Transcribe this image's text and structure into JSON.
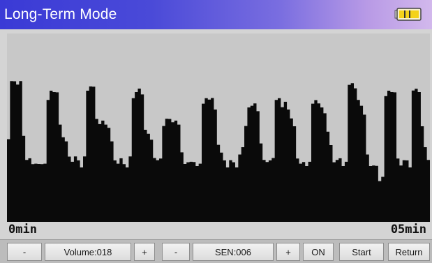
{
  "title": "Long-Term Mode",
  "status": {
    "battery_icon": "battery-icon",
    "battery_color": "#f4d21a"
  },
  "plot": {
    "start_label": "0min",
    "end_label": "05min",
    "background": "#c8c8c8",
    "signal_color": "#0a0a0a",
    "samples": [
      0.45,
      0.74,
      0.75,
      0.74,
      0.74,
      0.46,
      0.34,
      0.33,
      0.31,
      0.32,
      0.3,
      0.31,
      0.32,
      0.64,
      0.7,
      0.7,
      0.68,
      0.52,
      0.46,
      0.42,
      0.35,
      0.33,
      0.34,
      0.33,
      0.3,
      0.34,
      0.7,
      0.73,
      0.71,
      0.55,
      0.53,
      0.53,
      0.52,
      0.51,
      0.42,
      0.33,
      0.32,
      0.33,
      0.31,
      0.3,
      0.34,
      0.66,
      0.7,
      0.7,
      0.68,
      0.5,
      0.46,
      0.44,
      0.35,
      0.32,
      0.34,
      0.52,
      0.54,
      0.55,
      0.54,
      0.53,
      0.52,
      0.38,
      0.3,
      0.32,
      0.33,
      0.31,
      0.3,
      0.32,
      0.62,
      0.66,
      0.66,
      0.65,
      0.6,
      0.42,
      0.36,
      0.33,
      0.3,
      0.32,
      0.32,
      0.3,
      0.35,
      0.4,
      0.52,
      0.6,
      0.62,
      0.64,
      0.58,
      0.42,
      0.34,
      0.31,
      0.33,
      0.35,
      0.64,
      0.66,
      0.62,
      0.63,
      0.6,
      0.56,
      0.5,
      0.34,
      0.32,
      0.31,
      0.3,
      0.33,
      0.62,
      0.65,
      0.64,
      0.6,
      0.58,
      0.49,
      0.4,
      0.32,
      0.34,
      0.33,
      0.3,
      0.33,
      0.72,
      0.74,
      0.72,
      0.64,
      0.62,
      0.58,
      0.35,
      0.3,
      0.31,
      0.29,
      0.22,
      0.25,
      0.66,
      0.7,
      0.7,
      0.68,
      0.34,
      0.31,
      0.32,
      0.33,
      0.3,
      0.69,
      0.71,
      0.7,
      0.5,
      0.4,
      0.34
    ]
  },
  "toolbar": {
    "vol_minus": "-",
    "volume": "Volume:018",
    "vol_plus": "+",
    "sen_minus": "-",
    "sensitivity": "SEN:006",
    "sen_plus": "+",
    "on": "ON",
    "start": "Start",
    "return": "Return"
  }
}
